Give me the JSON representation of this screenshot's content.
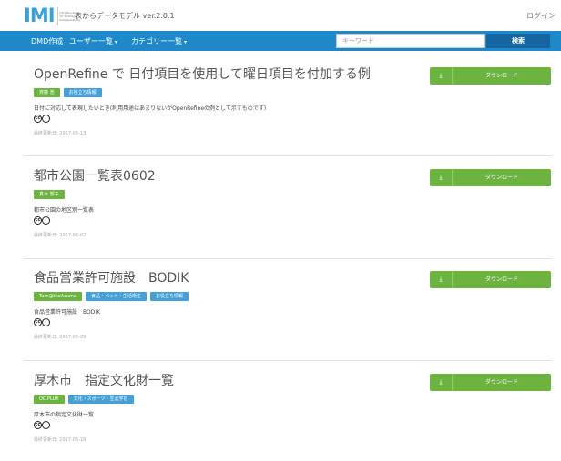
{
  "header": {
    "logo_text": "IMI",
    "logo_sub": "Infrastructure for Multilayer Interoperability",
    "site_title": "表からデータモデル ver.2.0.1",
    "login_label": "ログイン"
  },
  "nav": {
    "items": [
      {
        "label": "DMD作成",
        "caret": false
      },
      {
        "label": "ユーザー一覧",
        "caret": true
      },
      {
        "label": "カテゴリー一覧",
        "caret": true
      }
    ],
    "search_placeholder": "キーワード",
    "search_button": "検索"
  },
  "download_label": "ダウンロード",
  "items": [
    {
      "title": "OpenRefine で 日付項目を使用して曜日項目を付加する例",
      "tags": [
        {
          "label": "齊藤 浩",
          "color": "green"
        },
        {
          "label": "お役立ち情報",
          "color": "blue"
        }
      ],
      "description": "日付に対応して表現したいとき(利用用途はあまりないがOpenRefineの例として示すものです)",
      "date": "最終更新日: 2017-05-13"
    },
    {
      "title": "都市公園一覧表0602",
      "tags": [
        {
          "label": "真木 鄯子",
          "color": "green"
        }
      ],
      "description": "都市公園の地区別一覧表",
      "date": "最終更新日: 2017-06-02"
    },
    {
      "title": "食品営業許可施設　BODIK",
      "tags": [
        {
          "label": "Turn@theAzuma",
          "color": "green"
        },
        {
          "label": "食品・ペット・生活衛生",
          "color": "blue"
        },
        {
          "label": "お役立ち情報",
          "color": "blue"
        }
      ],
      "description": "食品営業許可施設　BODIK",
      "date": "最終更新日: 2017-05-29"
    },
    {
      "title": "厚木市　指定文化財一覧",
      "tags": [
        {
          "label": "OC.PLUX",
          "color": "green"
        },
        {
          "label": "文化・スポーツ・生涯学習",
          "color": "blue"
        }
      ],
      "description": "厚木市の指定文化財一覧",
      "date": "最終更新日: 2017-05-18"
    }
  ]
}
